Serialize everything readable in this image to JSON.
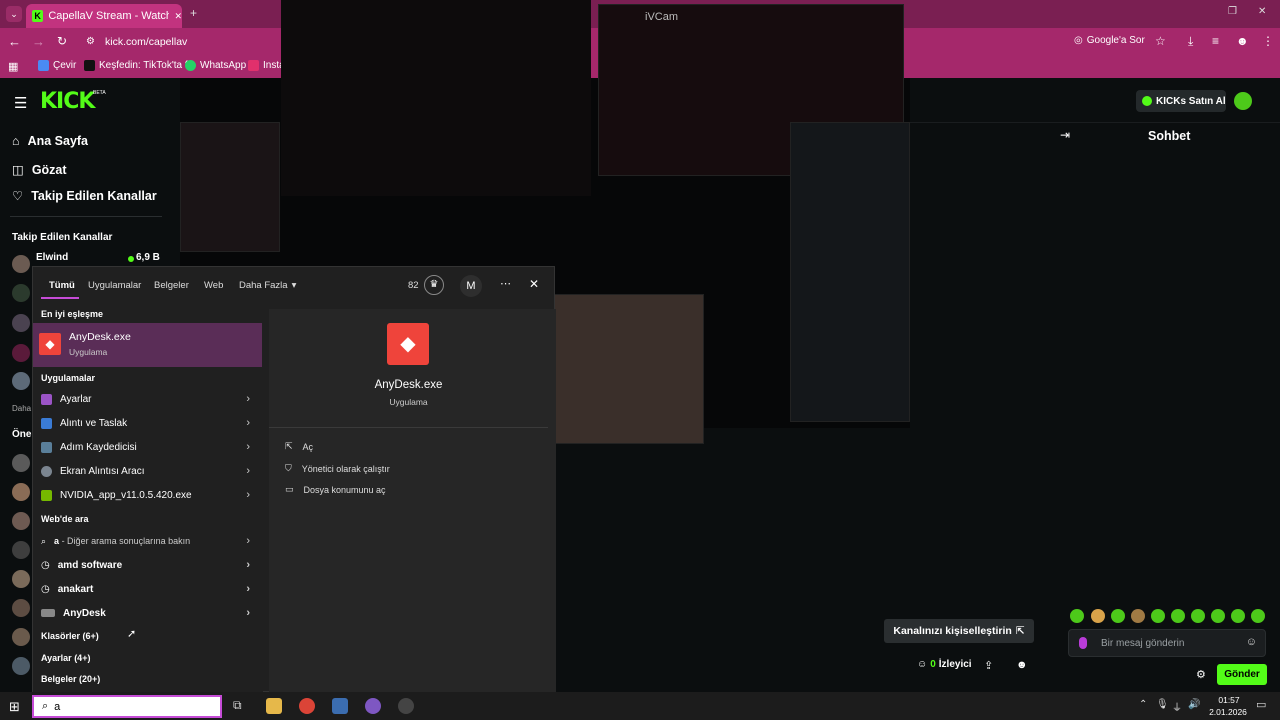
{
  "browser": {
    "tab_title": "CapellaV Stream - Watch Live o",
    "tab_close": "✕",
    "new_tab": "+",
    "url": "kick.com/capellav",
    "google_ask": "Google'a Sor",
    "bookmarks": [
      "Çevir",
      "Keşfedin: TikTok'ta f...",
      "WhatsApp",
      "Insta"
    ]
  },
  "overlay": {
    "ivcam_label": "iVCam"
  },
  "kick": {
    "logo": "KICK",
    "logo_beta": "BETA",
    "buy_kicks": "KICKs Satın Al",
    "nav": [
      "Ana Sayfa",
      "Gözat",
      "Takip Edilen Kanallar"
    ],
    "followed_heading": "Takip Edilen Kanallar",
    "followed_channel": {
      "name": "Elwind",
      "viewers": "6,9 B"
    },
    "more_label": "Daha",
    "recommended_label": "Öner",
    "customize_btn": "Kanalınızı kişiselleştirin",
    "viewers_count": "0",
    "viewers_label": "İzleyici",
    "chat_title": "Sohbet",
    "chat_placeholder": "Bir mesaj gönderin",
    "send_label": "Gönder"
  },
  "search_panel": {
    "tabs": [
      "Tümü",
      "Uygulamalar",
      "Belgeler",
      "Web",
      "Daha Fazla"
    ],
    "points": "82",
    "user_initial": "M",
    "best_match_heading": "En iyi eşleşme",
    "best_match": {
      "name": "AnyDesk.exe",
      "type": "Uygulama"
    },
    "apps_heading": "Uygulamalar",
    "apps": [
      "Ayarlar",
      "Alıntı ve Taslak",
      "Adım Kaydedicisi",
      "Ekran Alıntısı Aracı",
      "NVIDIA_app_v11.0.5.420.exe"
    ],
    "web_heading": "Web'de ara",
    "web_first_query": "a",
    "web_first_suffix": " - Diğer arama sonuçlarına bakın",
    "web": [
      "amd software",
      "anakart",
      "AnyDesk"
    ],
    "folders": "Klasörler (6+)",
    "settings": "Ayarlar (4+)",
    "documents": "Belgeler (20+)",
    "detail": {
      "name": "AnyDesk.exe",
      "type": "Uygulama",
      "actions": [
        "Aç",
        "Yönetici olarak çalıştır",
        "Dosya konumunu aç"
      ]
    }
  },
  "taskbar": {
    "search_text": "a",
    "time": "01:57",
    "date": "2.01.2026"
  },
  "colors": {
    "browser_tab_bg": "#7a1f52",
    "browser_toolbar": "#a5286b",
    "kick_green": "#53fc18",
    "anydesk_red": "#ef443b",
    "search_selected": "#5a2d57"
  }
}
